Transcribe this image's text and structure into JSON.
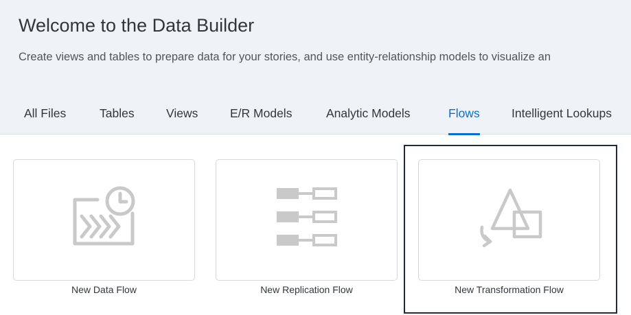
{
  "header": {
    "title": "Welcome to the Data Builder",
    "subtitle": "Create views and tables to prepare data for your stories, and use entity-relationship models to visualize an"
  },
  "tabs": [
    {
      "label": "All Files"
    },
    {
      "label": "Tables"
    },
    {
      "label": "Views"
    },
    {
      "label": "E/R Models"
    },
    {
      "label": "Analytic Models"
    },
    {
      "label": "Flows",
      "active": true
    },
    {
      "label": "Intelligent Lookups"
    }
  ],
  "cards": [
    {
      "label": "New Data Flow",
      "icon": "data-flow-icon"
    },
    {
      "label": "New Replication Flow",
      "icon": "replication-flow-icon"
    },
    {
      "label": "New Transformation Flow",
      "icon": "transformation-flow-icon",
      "selected": true
    }
  ],
  "colors": {
    "header_bg": "#eff3f7",
    "accent": "#0a6ed1",
    "icon_gray": "#c9c9c9",
    "selection_border": "#1d2a40"
  }
}
